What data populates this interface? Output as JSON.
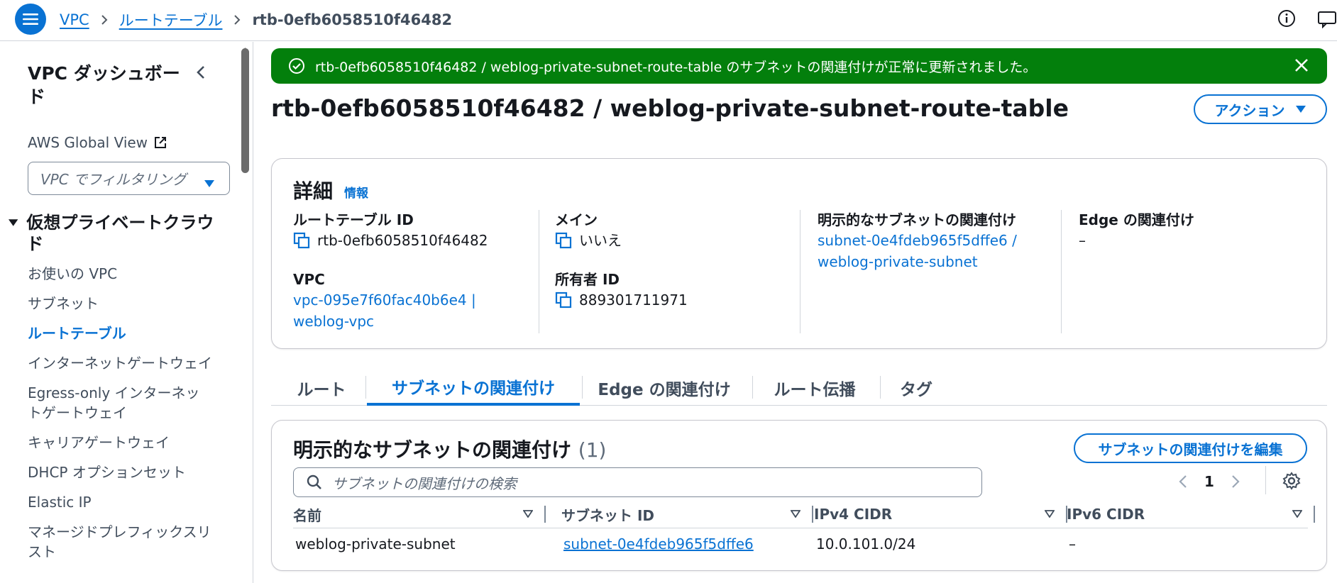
{
  "breadcrumb": {
    "items": [
      "VPC",
      "ルートテーブル"
    ],
    "current": "rtb-0efb6058510f46482"
  },
  "sidebar": {
    "title": "VPC ダッシュボード",
    "global_view": "AWS Global View",
    "filter_placeholder": "VPC でフィルタリング",
    "section": "仮想プライベートクラウド",
    "items": [
      {
        "label": "お使いの VPC"
      },
      {
        "label": "サブネット"
      },
      {
        "label": "ルートテーブル",
        "active": true
      },
      {
        "label": "インターネットゲートウェイ"
      },
      {
        "label": "Egress-only インターネットゲートウェイ"
      },
      {
        "label": "キャリアゲートウェイ"
      },
      {
        "label": "DHCP オプションセット"
      },
      {
        "label": "Elastic IP"
      },
      {
        "label": "マネージドプレフィックスリスト"
      }
    ]
  },
  "flash": {
    "message": "rtb-0efb6058510f46482 / weblog-private-subnet-route-table のサブネットの関連付けが正常に更新されました。",
    "color": "#037f0c"
  },
  "page": {
    "title": "rtb-0efb6058510f46482 / weblog-private-subnet-route-table",
    "action_label": "アクション"
  },
  "details": {
    "heading": "詳細",
    "info": "情報",
    "route_table_id": {
      "label": "ルートテーブル ID",
      "value": "rtb-0efb6058510f46482"
    },
    "vpc": {
      "label": "VPC",
      "value": "vpc-095e7f60fac40b6e4 |",
      "value2": "weblog-vpc"
    },
    "main": {
      "label": "メイン",
      "value": "いいえ"
    },
    "owner": {
      "label": "所有者 ID",
      "value": "889301711971"
    },
    "explicit": {
      "label": "明示的なサブネットの関連付け",
      "value": "subnet-0e4fdeb965f5dffe6 /",
      "value2": "weblog-private-subnet"
    },
    "edge": {
      "label": "Edge の関連付け",
      "value": "–"
    }
  },
  "tabs": [
    {
      "label": "ルート"
    },
    {
      "label": "サブネットの関連付け",
      "active": true
    },
    {
      "label": "Edge の関連付け"
    },
    {
      "label": "ルート伝播"
    },
    {
      "label": "タグ"
    }
  ],
  "associations": {
    "heading": "明示的なサブネットの関連付け",
    "count": "(1)",
    "edit_label": "サブネットの関連付けを編集",
    "search_placeholder": "サブネットの関連付けの検索",
    "page": "1",
    "columns": [
      "名前",
      "サブネット ID",
      "IPv4 CIDR",
      "IPv6 CIDR"
    ],
    "rows": [
      {
        "name": "weblog-private-subnet",
        "subnet_id": "subnet-0e4fdeb965f5dffe6",
        "ipv4": "10.0.101.0/24",
        "ipv6": "–"
      }
    ]
  },
  "colors": {
    "accent": "#0972d3",
    "success": "#037f0c"
  }
}
